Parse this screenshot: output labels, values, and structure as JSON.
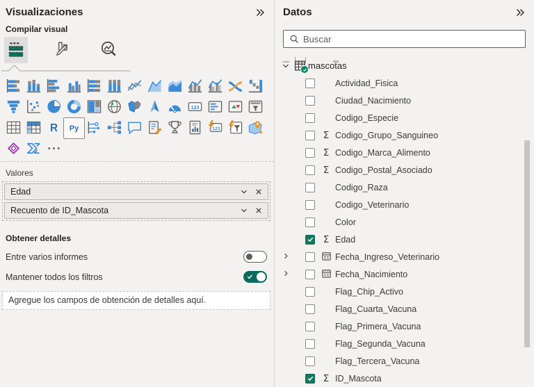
{
  "left_panel": {
    "title": "Visualizaciones",
    "collapse_icon": "chevron-double-right-icon",
    "build_label": "Compilar visual",
    "tabs": [
      {
        "name": "build-visual",
        "selected": true
      },
      {
        "name": "format-visual",
        "selected": false
      },
      {
        "name": "analytics",
        "selected": false
      }
    ],
    "gallery": [
      "stacked-bar-chart",
      "stacked-column-chart",
      "clustered-bar-chart",
      "clustered-column-chart",
      "hundred-stacked-bar-chart",
      "hundred-stacked-column-chart",
      "line-chart",
      "area-chart",
      "stacked-area-chart",
      "line-and-stacked-column-chart",
      "line-and-clustered-column-chart",
      "ribbon-chart",
      "waterfall-chart",
      "funnel-chart",
      "scatter-chart",
      "pie-chart",
      "donut-chart",
      "treemap",
      "map",
      "filled-map",
      "azure-map",
      "gauge",
      "card",
      "multi-row-card",
      "kpi",
      "slicer",
      "table",
      "matrix",
      "r-script-visual",
      "python-visual",
      "key-influencers",
      "decomposition-tree",
      "q-and-a",
      "smart-narrative",
      "metrics",
      "paginated-report",
      "new-card",
      "new-slicer",
      "arcgis-map",
      "power-apps",
      "power-automate",
      "more-visuals"
    ],
    "selected_visual": "python-visual",
    "values_well": {
      "label": "Valores",
      "fields": [
        {
          "name": "Edad"
        },
        {
          "name": "Recuento de ID_Mascota"
        }
      ]
    },
    "drillthrough": {
      "title": "Obtener detalles",
      "toggles": [
        {
          "label": "Entre varios informes",
          "on": false
        },
        {
          "label": "Mantener todos los filtros",
          "on": true
        }
      ],
      "dropzone": "Agregue los campos de obtención de detalles aquí."
    }
  },
  "right_panel": {
    "title": "Datos",
    "collapse_icon": "chevron-double-right-icon",
    "search": {
      "placeholder": "Buscar"
    },
    "tree": {
      "table": {
        "name": "mascotas",
        "expanded": true,
        "selection_badge": true
      },
      "fields": [
        {
          "label": "Actividad_Fisica",
          "icon": null,
          "checked": false,
          "expandable": false
        },
        {
          "label": "Ciudad_Nacimiento",
          "icon": null,
          "checked": false,
          "expandable": false
        },
        {
          "label": "Codigo_Especie",
          "icon": null,
          "checked": false,
          "expandable": false
        },
        {
          "label": "Codigo_Grupo_Sanguineo",
          "icon": "sigma",
          "checked": false,
          "expandable": false
        },
        {
          "label": "Codigo_Marca_Alimento",
          "icon": "sigma",
          "checked": false,
          "expandable": false
        },
        {
          "label": "Codigo_Postal_Asociado",
          "icon": "sigma",
          "checked": false,
          "expandable": false
        },
        {
          "label": "Codigo_Raza",
          "icon": null,
          "checked": false,
          "expandable": false
        },
        {
          "label": "Codigo_Veterinario",
          "icon": null,
          "checked": false,
          "expandable": false
        },
        {
          "label": "Color",
          "icon": null,
          "checked": false,
          "expandable": false
        },
        {
          "label": "Edad",
          "icon": "sigma",
          "checked": true,
          "expandable": false
        },
        {
          "label": "Fecha_Ingreso_Veterinario",
          "icon": "date",
          "checked": false,
          "expandable": true
        },
        {
          "label": "Fecha_Nacimiento",
          "icon": "date",
          "checked": false,
          "expandable": true
        },
        {
          "label": "Flag_Chip_Activo",
          "icon": null,
          "checked": false,
          "expandable": false
        },
        {
          "label": "Flag_Cuarta_Vacuna",
          "icon": null,
          "checked": false,
          "expandable": false
        },
        {
          "label": "Flag_Primera_Vacuna",
          "icon": null,
          "checked": false,
          "expandable": false
        },
        {
          "label": "Flag_Segunda_Vacuna",
          "icon": null,
          "checked": false,
          "expandable": false
        },
        {
          "label": "Flag_Tercera_Vacuna",
          "icon": null,
          "checked": false,
          "expandable": false
        },
        {
          "label": "ID_Mascota",
          "icon": "sigma",
          "checked": true,
          "expandable": false
        }
      ]
    }
  },
  "colors": {
    "panel_bg": "#F3F2F1",
    "accent_teal_toggle": "#0A6A5C",
    "accent_teal_checkbox": "#12795F",
    "badge_green": "#0C8465",
    "icon_blue": "#3E8BD5",
    "icon_gray": "#605E5C"
  }
}
